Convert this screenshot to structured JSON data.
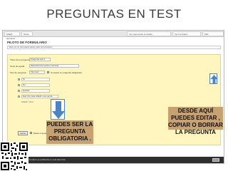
{
  "slide": {
    "title": "PREGUNTAS EN TEST"
  },
  "screenshot": {
    "browser_tabs": [
      "Añadir elemento",
      "Tema"
    ],
    "top_right_buttons": [
      "Ver respuestas enviadas",
      "Ver formulario",
      "Más"
    ],
    "form_title": "PILOTO DE FORMULARIO",
    "form_description": "Este es un formulario piloto para la formación",
    "question_fields": [
      {
        "label": "Título de la pregunta",
        "value": "Pregunta test 1"
      },
      {
        "label": "Texto de ayuda",
        "value": "Selecciona la opción correcta"
      },
      {
        "label": "Tipo de pregunta",
        "value": "Tipo test"
      }
    ],
    "required_label": "Convertir en pregunta obligatoria",
    "options": [
      "Sí",
      "No",
      "Quizás",
      "Haz clic para añadir una opción"
    ],
    "add_other_label": "Añadir \"Otro\"",
    "done_label": "Hecho",
    "done_checkbox_label": "Pasar a la página siguiente",
    "add_element_label": "Añadir elemento",
    "status_text": "Tu formulario se publicará en esta dirección"
  },
  "callouts": {
    "left": "PUEDES SER LA PREGUNTA OBLIGATORIA .",
    "right": "DESDE AQUÍ PUEDES EDITAR , COPIAR O BORRAR LA PREGUNTA"
  },
  "icons": {
    "arrow_up": "up-arrow-icon",
    "arrow_down": "down-arrow-icon",
    "qr": "qr-code"
  },
  "colors": {
    "question_bg": "#fff6bf",
    "callout_bg": "#c7a16f",
    "arrow_blue": "#4a84c8"
  }
}
